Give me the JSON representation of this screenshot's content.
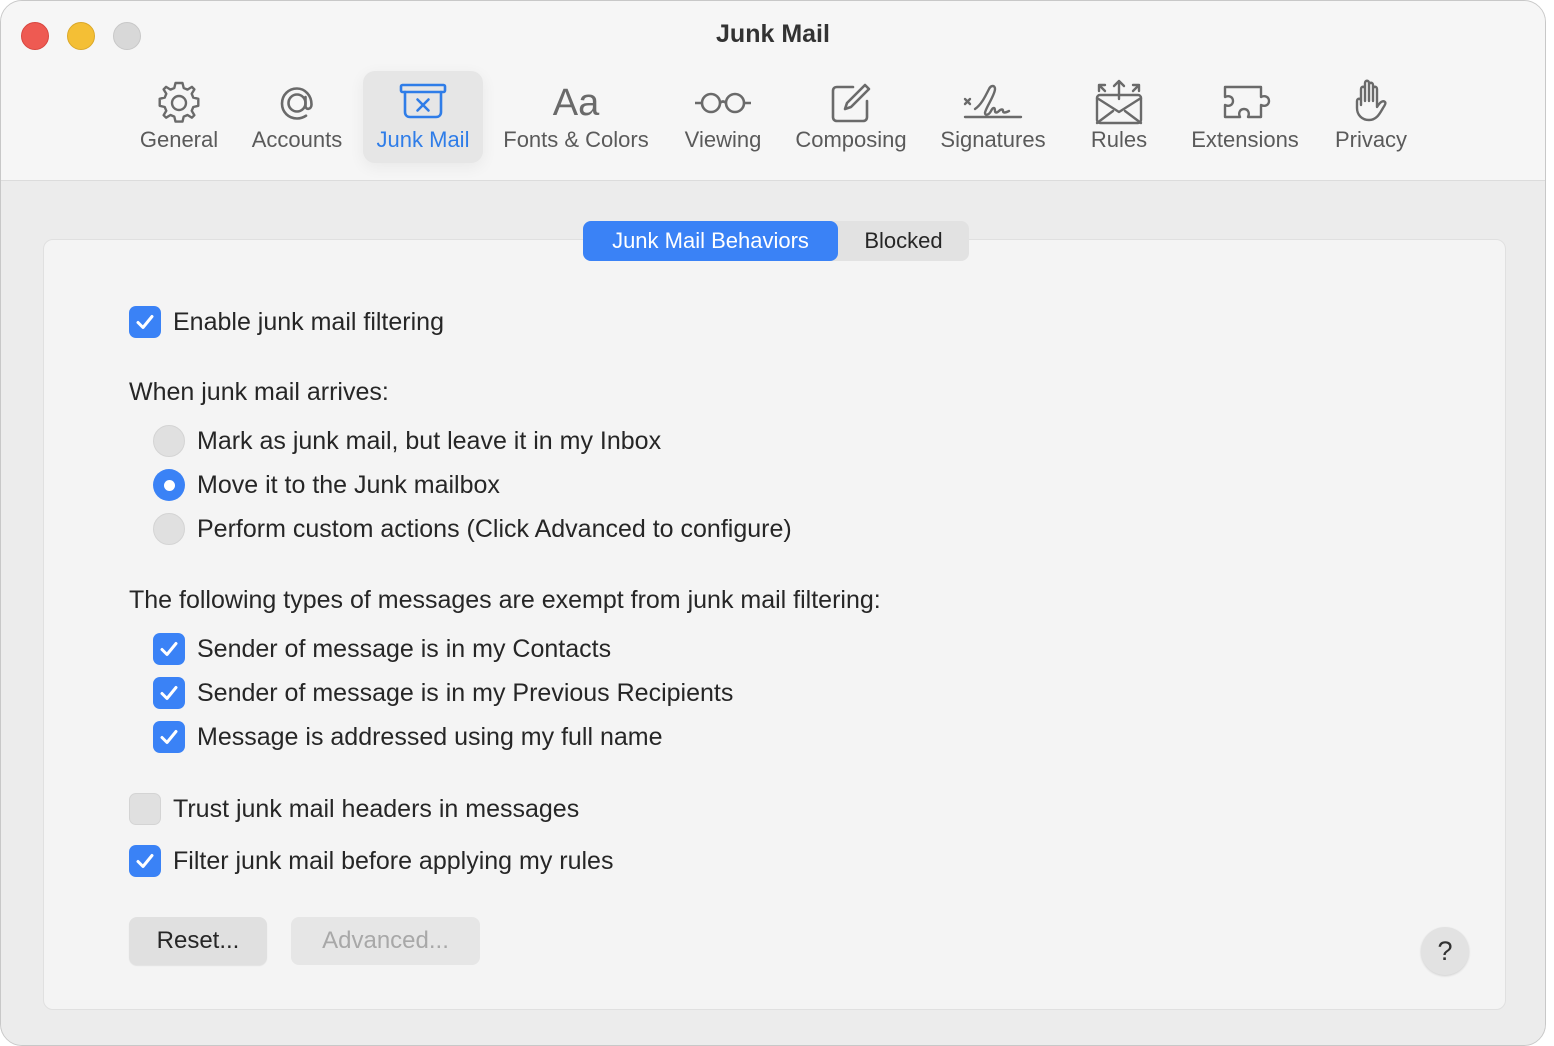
{
  "window": {
    "title": "Junk Mail"
  },
  "toolbar": {
    "items": [
      {
        "label": "General",
        "icon": "gear-icon"
      },
      {
        "label": "Accounts",
        "icon": "at-sign-icon"
      },
      {
        "label": "Junk Mail",
        "icon": "junk-tray-icon",
        "selected": true
      },
      {
        "label": "Fonts & Colors",
        "icon": "font-aa-icon"
      },
      {
        "label": "Viewing",
        "icon": "glasses-icon"
      },
      {
        "label": "Composing",
        "icon": "compose-pencil-icon"
      },
      {
        "label": "Signatures",
        "icon": "signature-icon"
      },
      {
        "label": "Rules",
        "icon": "envelope-arrows-icon"
      },
      {
        "label": "Extensions",
        "icon": "puzzle-piece-icon"
      },
      {
        "label": "Privacy",
        "icon": "raised-hand-icon"
      }
    ],
    "icon_glyph_aa": "Aa"
  },
  "tabs": {
    "active": "Junk Mail Behaviors",
    "inactive": "Blocked"
  },
  "settings": {
    "enable_filtering": {
      "label": "Enable junk mail filtering",
      "checked": true
    },
    "arrival_heading": "When junk mail arrives:",
    "arrival_options": [
      {
        "label": "Mark as junk mail, but leave it in my Inbox",
        "selected": false
      },
      {
        "label": "Move it to the Junk mailbox",
        "selected": true
      },
      {
        "label": "Perform custom actions (Click Advanced to configure)",
        "selected": false
      }
    ],
    "exempt_heading": "The following types of messages are exempt from junk mail filtering:",
    "exempt_options": [
      {
        "label": "Sender of message is in my Contacts",
        "checked": true
      },
      {
        "label": "Sender of message is in my Previous Recipients",
        "checked": true
      },
      {
        "label": "Message is addressed using my full name",
        "checked": true
      }
    ],
    "trust_headers": {
      "label": "Trust junk mail headers in messages",
      "checked": false
    },
    "filter_before_rules": {
      "label": "Filter junk mail before applying my rules",
      "checked": true
    }
  },
  "buttons": {
    "reset": "Reset...",
    "advanced": "Advanced...",
    "help": "?"
  },
  "colors": {
    "accent": "#3a82f6",
    "close": "#ee5a52",
    "minimize": "#f4bf35",
    "zoom_disabled": "#d8d8d8"
  }
}
